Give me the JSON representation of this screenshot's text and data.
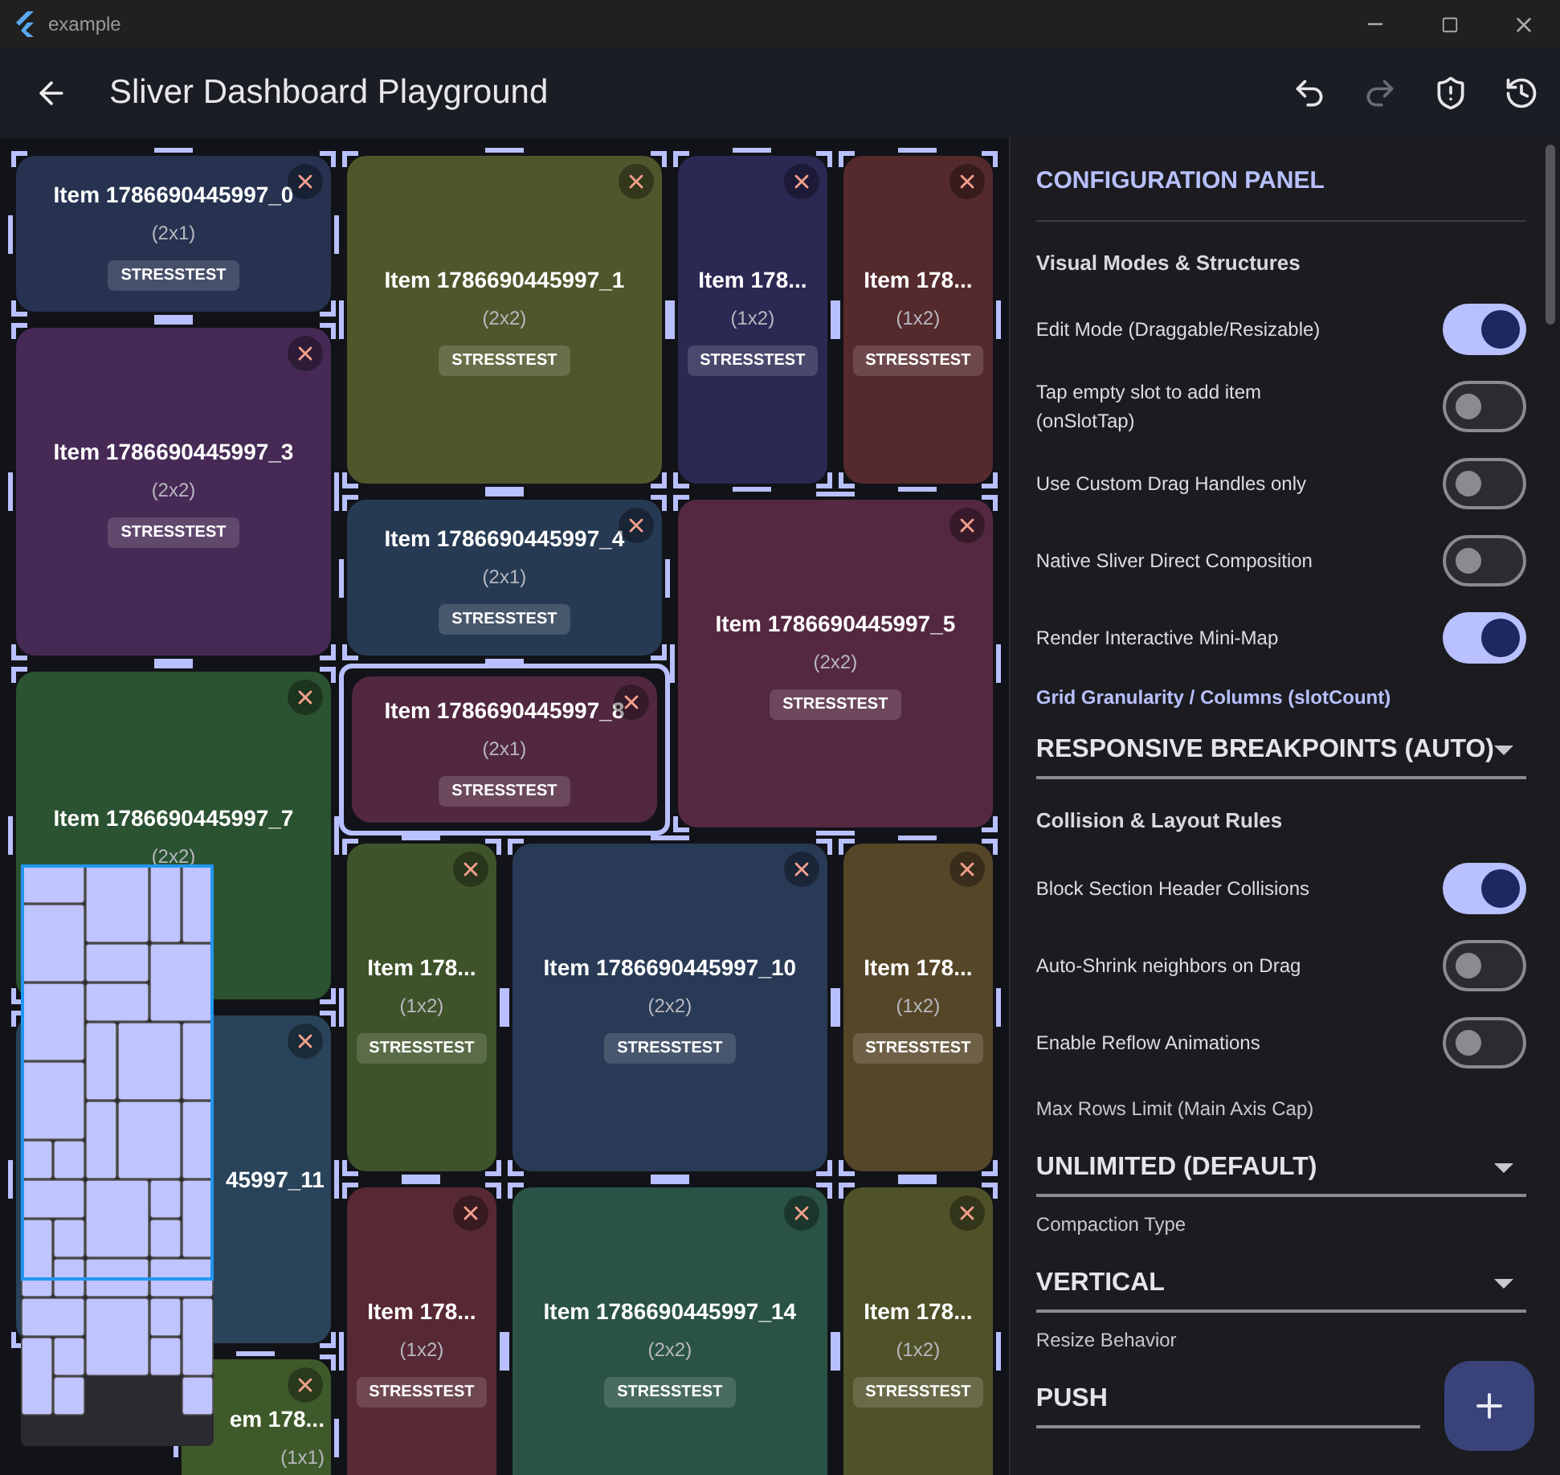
{
  "window": {
    "title": "example"
  },
  "app_bar": {
    "title": "Sliver Dashboard Playground",
    "actions": [
      {
        "kind": "undo",
        "disabled": false
      },
      {
        "kind": "redo",
        "disabled": true
      },
      {
        "kind": "shield",
        "disabled": false
      },
      {
        "kind": "history",
        "disabled": false
      }
    ]
  },
  "dashboard": {
    "items": [
      {
        "title": "Item 1786690445997_0",
        "size": "(2x1)",
        "tag": "STRESSTEST",
        "color": "#263250",
        "selected": false,
        "closable": true
      },
      {
        "title": "Item 1786690445997_1",
        "size": "(2x2)",
        "tag": "STRESSTEST",
        "color": "#4f562b",
        "selected": false,
        "closable": true
      },
      {
        "title": "Item 178...",
        "size": "(1x2)",
        "tag": "STRESSTEST",
        "color": "#2b2853",
        "selected": false,
        "closable": true
      },
      {
        "title": "Item 178...",
        "size": "(1x2)",
        "tag": "STRESSTEST",
        "color": "#552a2d",
        "selected": false,
        "closable": true
      },
      {
        "title": "Item 1786690445997_3",
        "size": "(2x2)",
        "tag": "STRESSTEST",
        "color": "#462a55",
        "selected": false,
        "closable": true
      },
      {
        "title": "Item 1786690445997_4",
        "size": "(2x1)",
        "tag": "STRESSTEST",
        "color": "#273a53",
        "selected": false,
        "closable": true
      },
      {
        "title": "Item 1786690445997_5",
        "size": "(2x2)",
        "tag": "STRESSTEST",
        "color": "#542840",
        "selected": false,
        "closable": true
      },
      {
        "title": "Item 1786690445997_7",
        "size": "(2x2)",
        "color": "#2b5231",
        "selected": false,
        "closable": true
      },
      {
        "title": "Item 1786690445997_8",
        "size": "(2x1)",
        "tag": "STRESSTEST",
        "color": "#522840",
        "selected": true,
        "closable": true
      },
      {
        "title": "Item 178...",
        "size": "(1x2)",
        "tag": "STRESSTEST",
        "color": "#3f532a",
        "selected": false,
        "closable": true
      },
      {
        "title": "Item 1786690445997_10",
        "size": "(2x2)",
        "tag": "STRESSTEST",
        "color": "#283a55",
        "selected": false,
        "closable": true
      },
      {
        "title": "Item 178...",
        "size": "(1x2)",
        "tag": "STRESSTEST",
        "color": "#564628",
        "selected": false,
        "closable": true
      },
      {
        "kind": "covered",
        "title": "45997_11",
        "color": "#29435a",
        "selected": false,
        "closable": true
      },
      {
        "title": "Item 178...",
        "size": "(1x2)",
        "tag": "STRESSTEST",
        "color": "#572934",
        "selected": false,
        "closable": true
      },
      {
        "title": "Item 1786690445997_14",
        "size": "(2x2)",
        "tag": "STRESSTEST",
        "color": "#2a5345",
        "selected": false,
        "closable": true
      },
      {
        "title": "Item 178...",
        "size": "(1x2)",
        "tag": "STRESSTEST",
        "color": "#4f5228",
        "selected": false,
        "closable": true
      },
      {
        "kind": "covered",
        "title": "em 178...",
        "size": "(1x1)",
        "color": "#3f5a2a",
        "selected": false,
        "closable": true
      }
    ]
  },
  "panel": {
    "title": "CONFIGURATION PANEL",
    "items": [
      {
        "kind": "section",
        "text": "Visual Modes & Structures"
      },
      {
        "kind": "toggle",
        "label": "Edit Mode (Draggable/Resizable)",
        "on": true
      },
      {
        "kind": "toggle",
        "label": "Tap empty slot to add item (onSlotTap)",
        "on": false
      },
      {
        "kind": "toggle",
        "label": "Use Custom Drag Handles only",
        "on": false
      },
      {
        "kind": "toggle",
        "label": "Native Sliver Direct Composition",
        "on": false
      },
      {
        "kind": "toggle",
        "label": "Render Interactive Mini-Map",
        "on": true
      },
      {
        "kind": "caption",
        "text": "Grid Granularity / Columns (slotCount)"
      },
      {
        "kind": "select",
        "value": "RESPONSIVE BREAKPOINTS (AUTO)"
      },
      {
        "kind": "section",
        "text": "Collision & Layout Rules"
      },
      {
        "kind": "toggle",
        "label": "Block Section Header Collisions",
        "on": true
      },
      {
        "kind": "toggle",
        "label": "Auto-Shrink neighbors on Drag",
        "on": false
      },
      {
        "kind": "toggle",
        "label": "Enable Reflow Animations",
        "on": false
      },
      {
        "kind": "select",
        "label": "Max Rows Limit (Main Axis Cap)",
        "value": "UNLIMITED (DEFAULT)"
      },
      {
        "kind": "select",
        "label": "Compaction Type",
        "value": "VERTICAL"
      },
      {
        "kind": "select",
        "label": "Resize Behavior",
        "value": "PUSH",
        "arrow": false
      }
    ]
  }
}
